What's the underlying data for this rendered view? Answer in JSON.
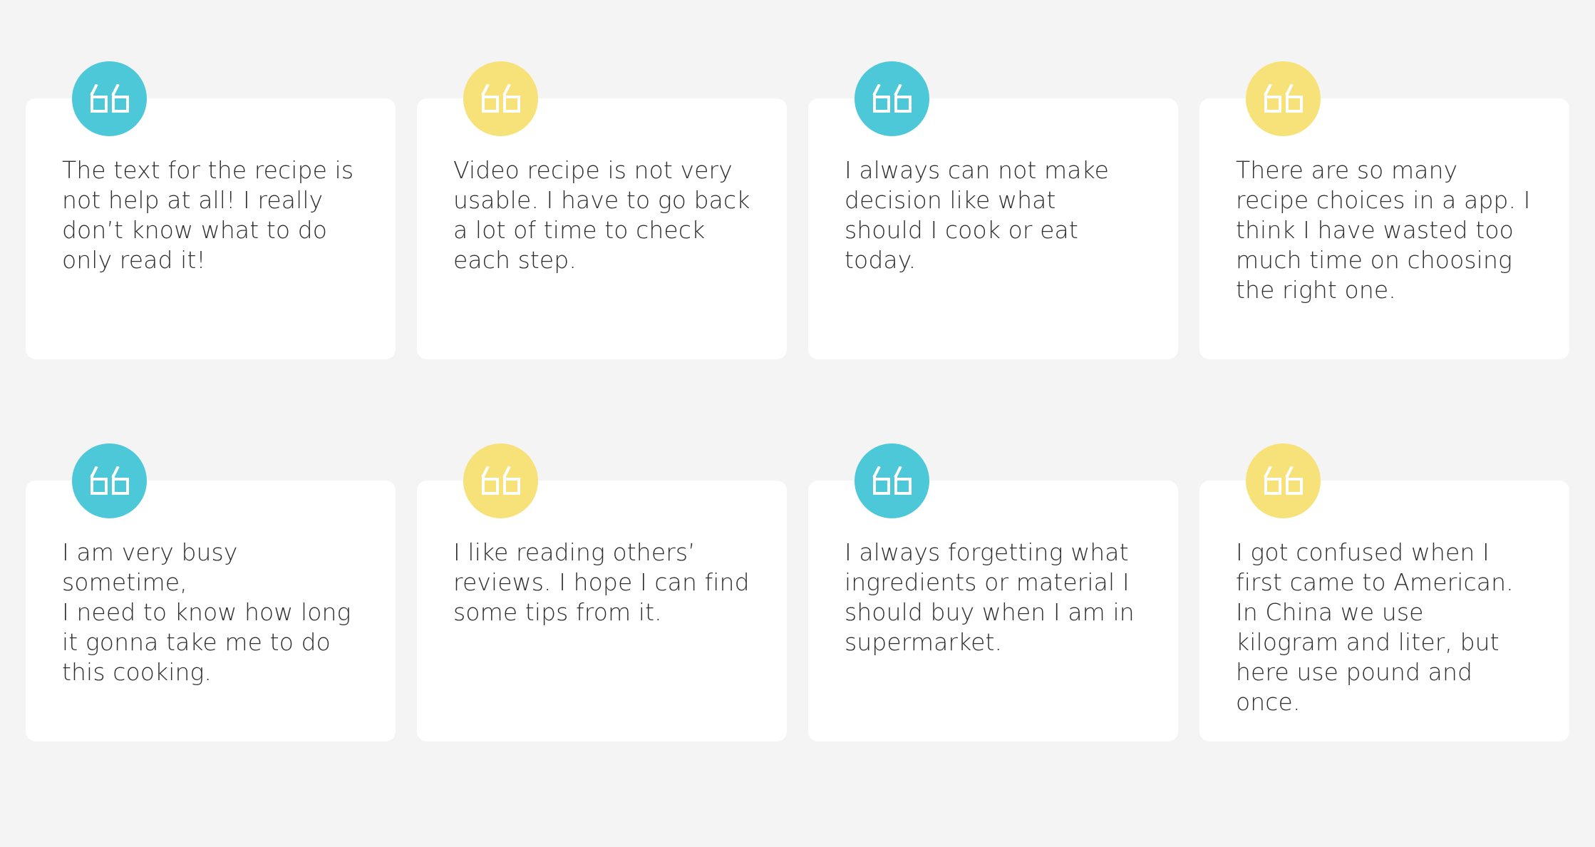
{
  "colors": {
    "background": "#f4f4f4",
    "card": "#ffffff",
    "accent_teal": "#4cc8d8",
    "accent_yellow": "#f7e27a",
    "text": "#2f2f2f"
  },
  "quote_icon": "quote-open-icon",
  "cards": [
    {
      "accent": "#4cc8d8",
      "text": "The text for the recipe is\nnot help at all! I really\ndon’t know what to do\nonly read it!"
    },
    {
      "accent": "#f7e27a",
      "text": "Video recipe is not very\nusable. I have to go back\na lot of time to check\neach step."
    },
    {
      "accent": "#4cc8d8",
      "text": "I always can not make\ndecision like what\nshould I cook or eat\ntoday."
    },
    {
      "accent": "#f7e27a",
      "text": "There are so many\nrecipe choices in a app. I\nthink I have wasted too\nmuch time on choosing\nthe right one."
    },
    {
      "accent": "#4cc8d8",
      "text": "I am very busy\nsometime,\nI need to know how long\nit gonna take me to do\nthis cooking."
    },
    {
      "accent": "#f7e27a",
      "text": "I like reading others’\nreviews. I hope I can find\nsome tips from it."
    },
    {
      "accent": "#4cc8d8",
      "text": "I always forgetting what\ningredients or material I\nshould buy when I am in\nsupermarket."
    },
    {
      "accent": "#f7e27a",
      "text": "I got confused when I\nfirst came to American.\nIn China we use\nkilogram and liter, but\nhere use pound and\nonce."
    }
  ]
}
